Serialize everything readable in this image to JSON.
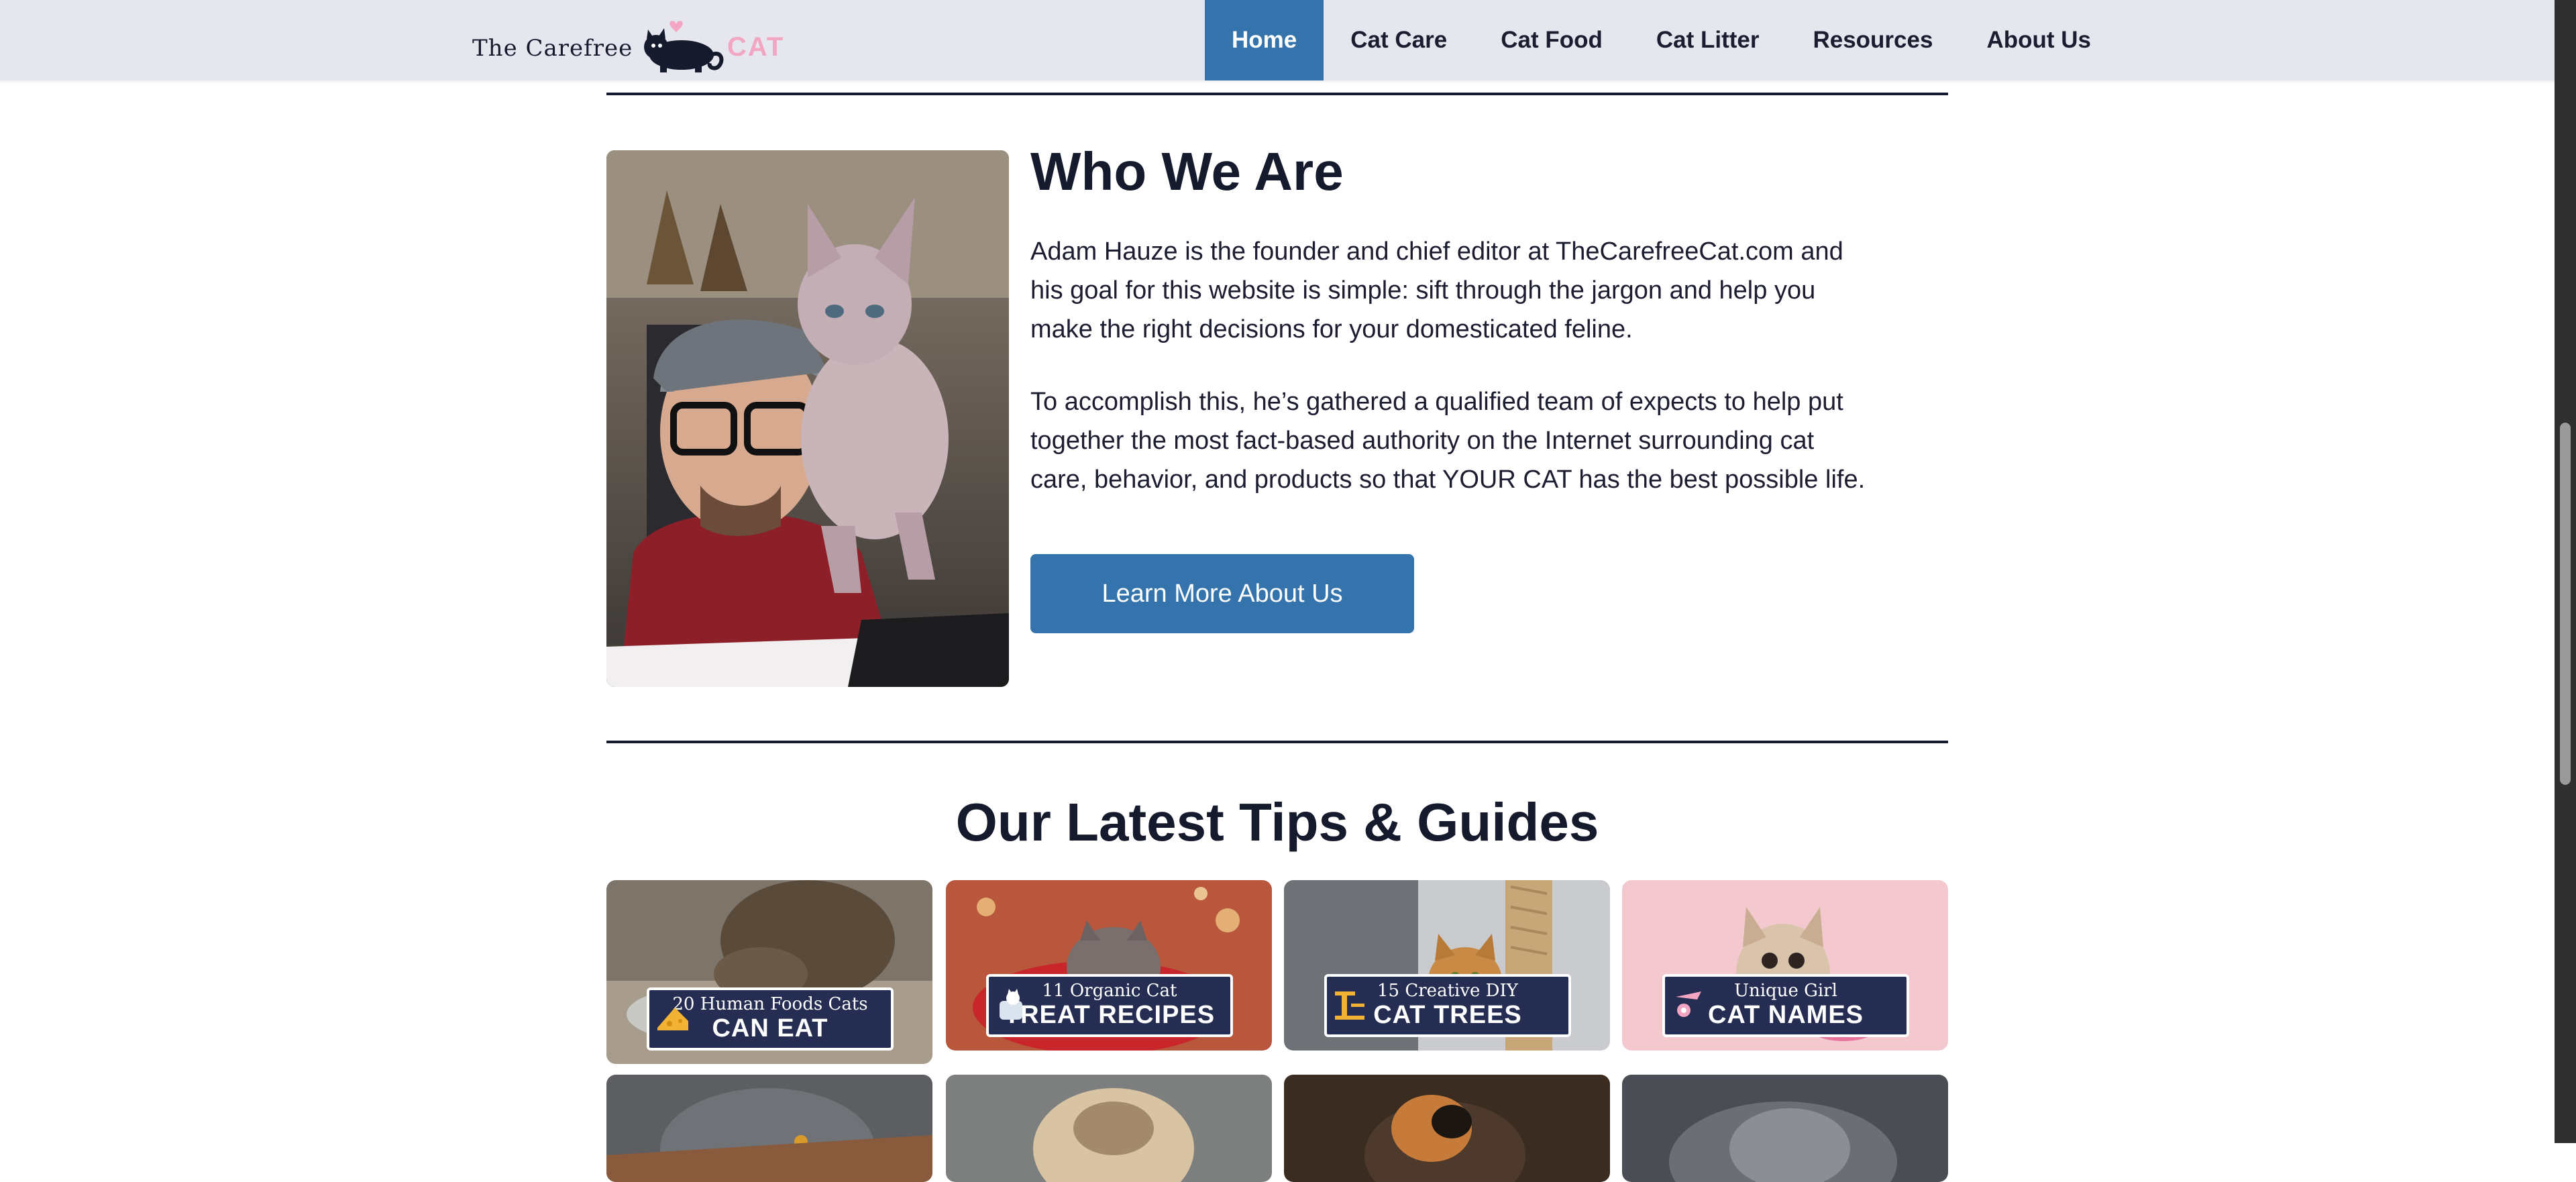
{
  "header": {
    "logo": {
      "text_part1": "The Carefree",
      "text_part2": "CAT"
    },
    "nav": [
      {
        "label": "Home",
        "active": true
      },
      {
        "label": "Cat Care",
        "active": false
      },
      {
        "label": "Cat Food",
        "active": false
      },
      {
        "label": "Cat Litter",
        "active": false
      },
      {
        "label": "Resources",
        "active": false
      },
      {
        "label": "About Us",
        "active": false
      }
    ]
  },
  "about": {
    "title": "Who We Are",
    "paragraph1": "Adam Hauze is the founder and chief editor at TheCarefreeCat.com and his goal for this website is simple: sift through the jargon and help you make the right decisions for your domesticated feline.",
    "paragraph2": "To accomplish this, he’s gathered a qualified team of expects to help put together the most fact-based authority on the Internet surrounding cat care, behavior, and products so that YOUR CAT has the best possible life.",
    "button_label": "Learn More About Us"
  },
  "latest": {
    "title": "Our Latest Tips & Guides",
    "cards": [
      {
        "top": "20 Human Foods Cats",
        "bottom": "CAN EAT",
        "icon": "cheese-icon"
      },
      {
        "top": "11 Organic Cat",
        "bottom": "TREAT RECIPES",
        "icon": "cat-jar-icon"
      },
      {
        "top": "15 Creative DIY",
        "bottom": "CAT TREES",
        "icon": "cat-tree-icon"
      },
      {
        "top": "Unique Girl",
        "bottom": "CAT NAMES",
        "icon": "bow-icon"
      }
    ]
  },
  "colors": {
    "header_bg": "#e6e7ee",
    "accent": "#3573ac",
    "logo_pink": "#f3a6c1",
    "card_label_bg": "#252e52"
  }
}
